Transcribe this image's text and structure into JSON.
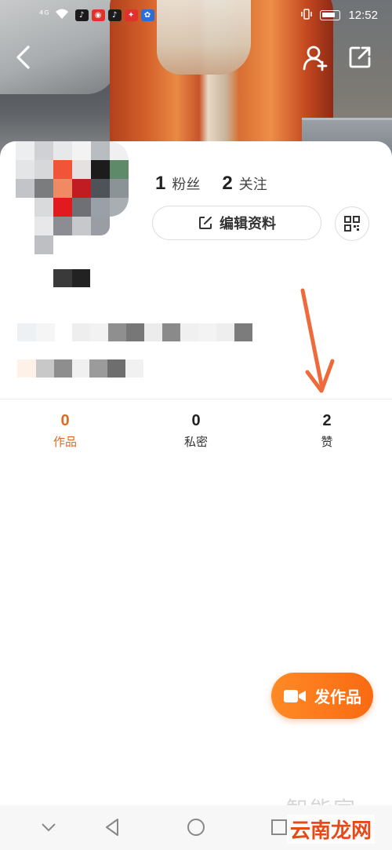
{
  "status_bar": {
    "signal": "⁴ᴳ",
    "time": "12:52"
  },
  "profile": {
    "followers_count": "1",
    "followers_label": "粉丝",
    "following_count": "2",
    "following_label": "关注",
    "edit_button_label": "编辑资料"
  },
  "tabs": [
    {
      "count": "0",
      "label": "作品",
      "active": true
    },
    {
      "count": "0",
      "label": "私密",
      "active": false
    },
    {
      "count": "2",
      "label": "赞",
      "active": false
    }
  ],
  "publish_button": {
    "label": "发作品"
  },
  "watermark": {
    "top": "智能家",
    "bottom": "云南龙网"
  },
  "colors": {
    "accent": "#e06a1f",
    "publish": "#f96a12",
    "arrow": "#ef6a3a"
  },
  "icons": [
    "back-icon",
    "add-friend-icon",
    "share-icon",
    "edit-icon",
    "qr-code-icon",
    "camera-icon",
    "nav-down-icon",
    "nav-back-icon",
    "nav-home-icon",
    "nav-recent-icon"
  ]
}
